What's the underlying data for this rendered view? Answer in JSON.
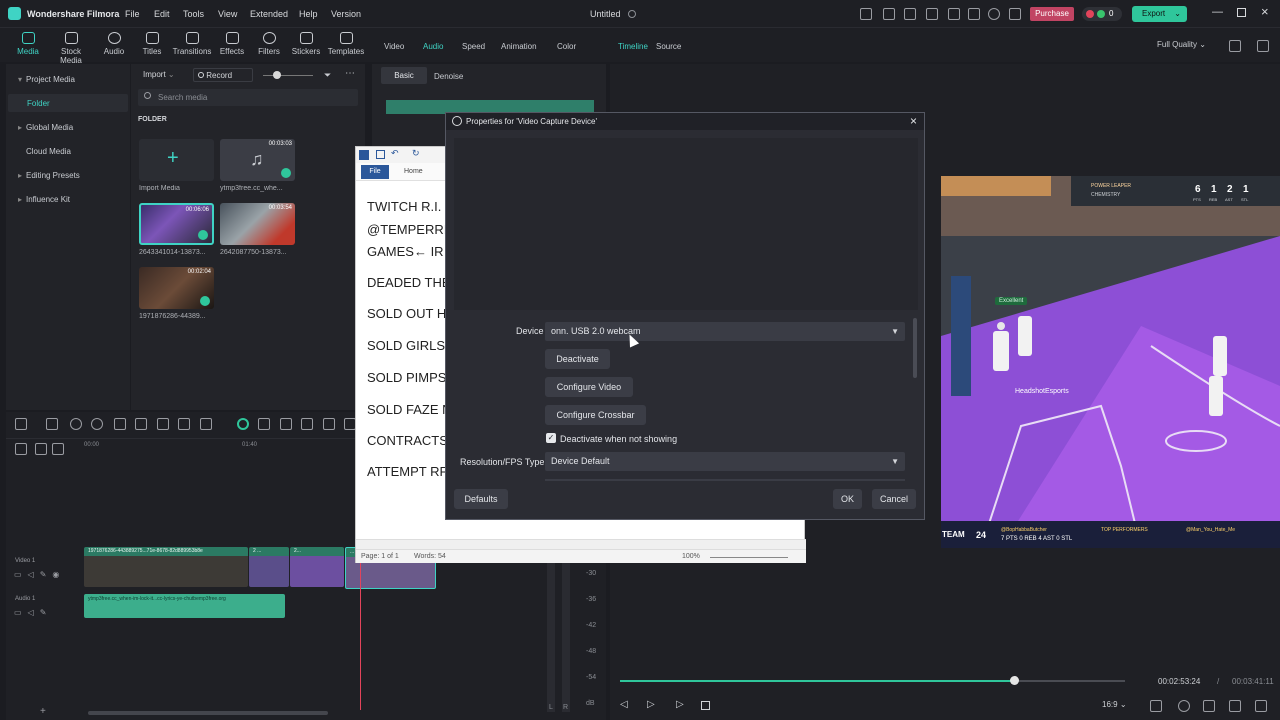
{
  "app": {
    "name": "Wondershare Filmora",
    "menu": [
      "File",
      "Edit",
      "Tools",
      "View",
      "Extended",
      "Help",
      "Version"
    ],
    "doc_title": "Untitled",
    "purchase_label": "Purchase",
    "credits": "0",
    "export_label": "Export"
  },
  "toolbar": {
    "tools": [
      "Media",
      "Stock Media",
      "Audio",
      "Titles",
      "Transitions",
      "Effects",
      "Filters",
      "Stickers",
      "Templates"
    ],
    "prop_tabs": [
      "Video",
      "Audio",
      "Speed",
      "Animation",
      "Color"
    ],
    "audio_subtabs": [
      "Basic",
      "Denoise"
    ],
    "view_tabs": [
      "Timeline",
      "Source"
    ],
    "quality": "Full Quality"
  },
  "sidebar": {
    "items": [
      {
        "label": "Project Media",
        "expanded": true
      },
      {
        "label": "Folder",
        "selected": true
      },
      {
        "label": "Global Media"
      },
      {
        "label": "Cloud Media"
      },
      {
        "label": "Editing Presets"
      },
      {
        "label": "Influence Kit"
      }
    ]
  },
  "media": {
    "import_label": "Import",
    "record_label": "Record",
    "search_placeholder": "Search media",
    "folder_header": "FOLDER",
    "import_tile_label": "Import Media",
    "items": [
      {
        "label": "ytmp3free.cc_whe...",
        "duration": "00:03:03"
      },
      {
        "label": "2643341014-13873...",
        "duration": "00:06:06"
      },
      {
        "label": "2642087750-13873...",
        "duration": "00:03:54"
      },
      {
        "label": "1971876286-44389...",
        "duration": "00:02:04"
      }
    ]
  },
  "timeline": {
    "ruler": [
      "00:00",
      "01:40"
    ],
    "tracks": [
      {
        "label": "Video 1"
      },
      {
        "label": "Audio 1"
      }
    ],
    "video_clip_labels": [
      "1971876286-443889275...71e-8678-82d889953b8e",
      "2 ...",
      "2...",
      "..."
    ],
    "audio_clip_label": "ytmp3free.cc_when-im-lock-it...cc-lyrics-ye-chutbemp3free.org",
    "audio_meter_ticks": [
      "-30",
      "-36",
      "-42",
      "-48",
      "-54",
      "dB"
    ],
    "meter_channels": [
      "L",
      "R"
    ]
  },
  "word_doc": {
    "tabs": [
      "File",
      "Home"
    ],
    "lines": [
      "TWITCH R.I.",
      "@TEMPERRI",
      "GAMES← IR",
      "DEADED THE",
      "SOLD OUT H",
      "SOLD GIRLS",
      "SOLD PIMPS",
      "SOLD FAZE N",
      "CONTRACTS",
      "ATTEMPT RF"
    ],
    "status_page": "Page: 1 of 1",
    "status_words": "Words: 54",
    "zoom": "100%"
  },
  "dialog": {
    "title": "Properties for 'Video Capture Device'",
    "device_label": "Device",
    "device_value": "onn. USB 2.0 webcam",
    "buttons": {
      "deactivate": "Deactivate",
      "configure_video": "Configure Video",
      "configure_crossbar": "Configure Crossbar"
    },
    "checkbox_label": "Deactivate when not showing",
    "checkbox_checked": true,
    "resolution_label": "Resolution/FPS Type",
    "resolution_value": "Device Default",
    "defaults_label": "Defaults",
    "ok_label": "OK",
    "cancel_label": "Cancel"
  },
  "preview": {
    "hud": {
      "leader": "POWER LEAPER",
      "chemistry": "CHEMISTRY",
      "stats": [
        "6",
        "1",
        "2",
        "1"
      ],
      "stat_labels": [
        "PTS",
        "REB",
        "AST",
        "STL"
      ]
    },
    "badge": "Excellent",
    "player_tag": "HeadshotEsports",
    "ticker_team": "TEAM",
    "ticker_num": "24",
    "ticker_top": "TOP PERFORMERS",
    "ticker_stats": "7 PTS  0 REB  4 AST  0 STL",
    "ticker_user": "@BopHabbaButcher",
    "ticker_user2": "@Man_You_Hate_Me"
  },
  "player": {
    "current_time": "00:02:53:24",
    "separator": "/",
    "total_time": "00:03:41:11",
    "aspect": "16:9",
    "progress": 0.78
  }
}
